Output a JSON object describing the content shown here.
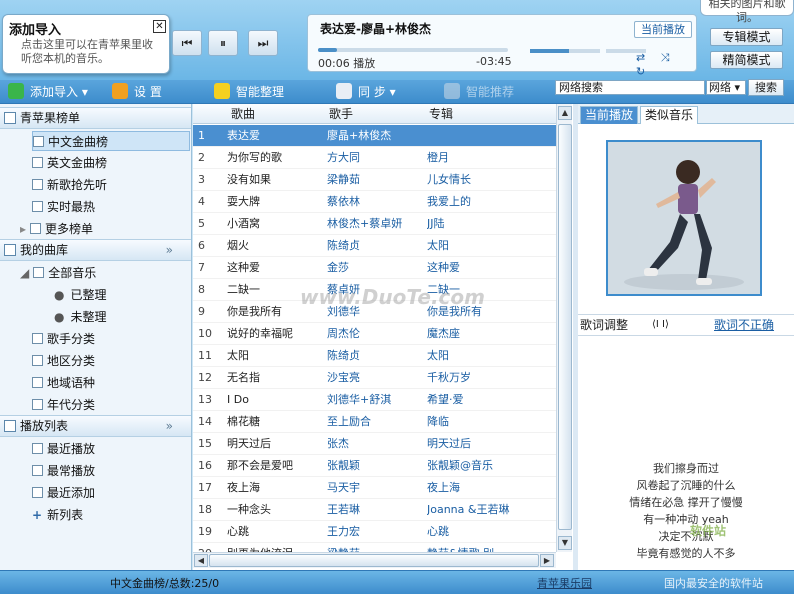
{
  "popup": {
    "title": "添加导入",
    "text": "点击这里可以在青苹果里收听您本机的音乐。",
    "close": "✕"
  },
  "topright_bubble": "相关的图片和歌词。",
  "player": {
    "prev_icon": "⏮",
    "pause_icon": "⏸",
    "next_icon": "⏭",
    "track": "表达爱-廖晶+林俊杰",
    "current_play": "当前播放",
    "elapsed": "00:06",
    "state": "播放",
    "remaining": "-03:45",
    "progress": 0.1,
    "volume": 0.55,
    "icons": "⇄ ⤨ ↻"
  },
  "modes": {
    "album": "专辑模式",
    "simple": "精简模式"
  },
  "toolbar": {
    "add": "添加导入",
    "settings": "设  置",
    "organize": "智能整理",
    "sync": "同  步",
    "recommend": "智能推荐"
  },
  "search": {
    "value": "网络搜索",
    "scope": "网络",
    "button": "搜索"
  },
  "sidebar": {
    "h1": "青苹果榜单",
    "h1_items": [
      "中文金曲榜",
      "英文金曲榜",
      "新歌抢先听",
      "实时最热",
      "更多榜单"
    ],
    "h2": "我的曲库",
    "h2_items": [
      "全部音乐",
      "已整理",
      "未整理",
      "歌手分类",
      "地区分类",
      "地域语种",
      "年代分类"
    ],
    "h3": "播放列表",
    "h3_items": [
      "最近播放",
      "最常播放",
      "最近添加",
      "新列表"
    ],
    "chevron": "»"
  },
  "list": {
    "col_song": "歌曲",
    "col_artist": "歌手",
    "col_album": "专辑",
    "rows": [
      [
        "1",
        "表达爱",
        "廖晶+林俊杰",
        ""
      ],
      [
        "2",
        "为你写的歌",
        "方大同",
        "橙月"
      ],
      [
        "3",
        "没有如果",
        "梁静茹",
        "儿女情长"
      ],
      [
        "4",
        "耍大牌",
        "蔡依林",
        "我爱上的"
      ],
      [
        "5",
        "小酒窝",
        "林俊杰+蔡卓妍",
        "JJ陆"
      ],
      [
        "6",
        "烟火",
        "陈绮贞",
        "太阳"
      ],
      [
        "7",
        "这种爱",
        "金莎",
        "这种爱"
      ],
      [
        "8",
        "二缺一",
        "蔡卓妍",
        "二缺一"
      ],
      [
        "9",
        "你是我所有",
        "刘德华",
        "你是我所有"
      ],
      [
        "10",
        "说好的幸福呢",
        "周杰伦",
        "魔杰座"
      ],
      [
        "11",
        "太阳",
        "陈绮贞",
        "太阳"
      ],
      [
        "12",
        "无名指",
        "沙宝亮",
        "千秋万岁"
      ],
      [
        "13",
        "I Do",
        "刘德华+舒淇",
        "希望·爱"
      ],
      [
        "14",
        "棉花糖",
        "至上励合",
        "降临"
      ],
      [
        "15",
        "明天过后",
        "张杰",
        "明天过后"
      ],
      [
        "16",
        "那不会是爱吧",
        "张靓颖",
        "张靓颖@音乐"
      ],
      [
        "17",
        "夜上海",
        "马天宇",
        "夜上海"
      ],
      [
        "18",
        "一种念头",
        "王若琳",
        "Joanna &王若琳"
      ],
      [
        "19",
        "心跳",
        "王力宏",
        "心跳"
      ],
      [
        "20",
        "别再为他流泪",
        "梁静茹",
        "静茹&情歌 别..."
      ],
      [
        "21",
        "爱...",
        "...",
        "..."
      ]
    ]
  },
  "right": {
    "tab_now": "当前播放",
    "tab_similar": "类似音乐",
    "lyric_adjust": "歌词调整",
    "lyric_arrows": "⟨I I⟩",
    "lyric_wrong": "歌词不正确",
    "lyrics": [
      "我们擦身而过",
      "风卷起了沉睡的什么",
      "情绪在必急  撑开了慢慢",
      "有一种冲动 yeah",
      "决定不沉默",
      "毕竟有感觉的人不多"
    ]
  },
  "status": {
    "left": "中文金曲榜/总数:25/0",
    "mid": "青苹果乐园"
  },
  "watermarks": {
    "center": "www.DuoTe.com",
    "corner": "国内最安全的软件站",
    "corner_brand": "软件站"
  },
  "colors": {
    "accent": "#3d8ccc",
    "selection": "#4a8fd0",
    "link": "#1a5ea3"
  }
}
